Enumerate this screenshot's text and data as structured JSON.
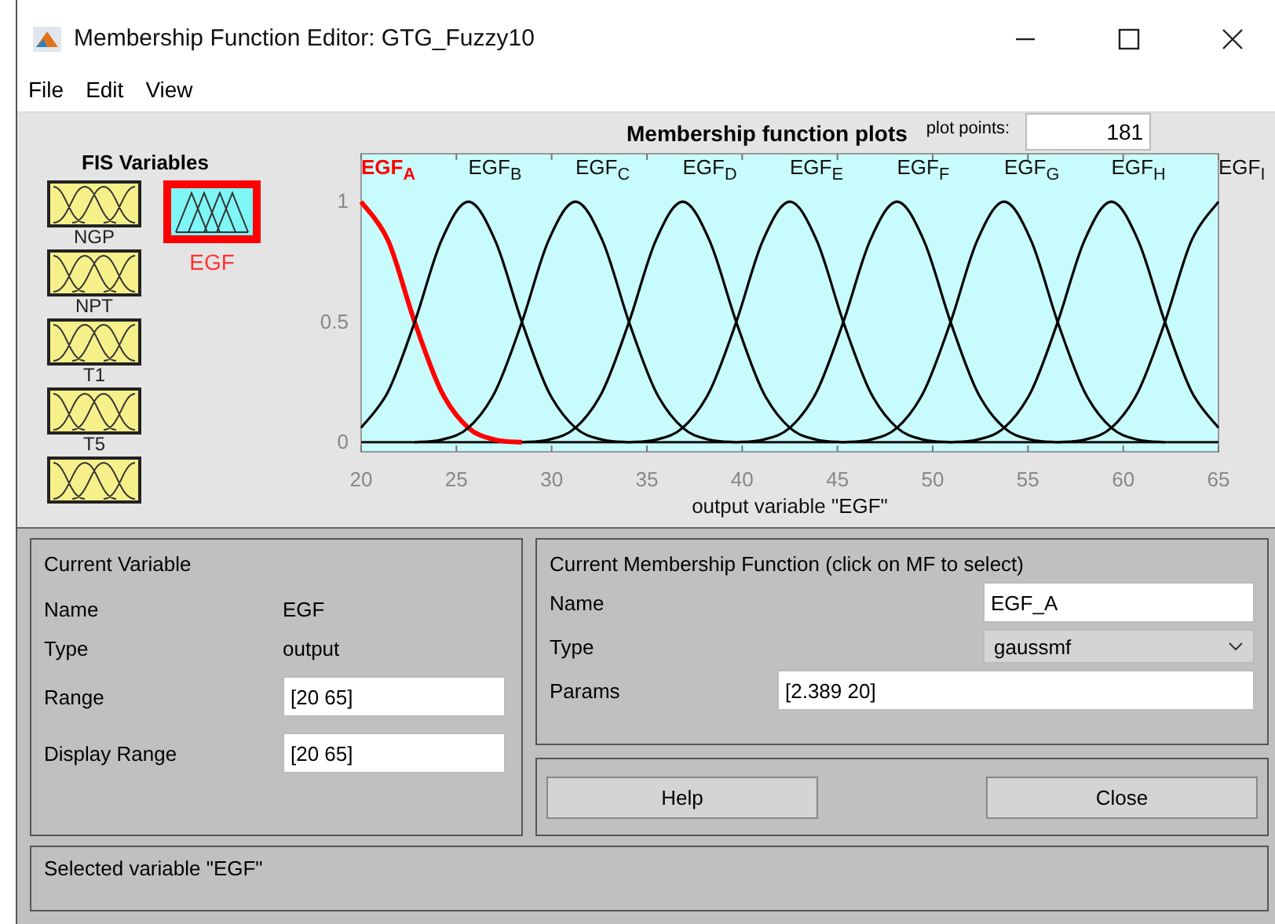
{
  "window": {
    "title": "Membership Function Editor: GTG_Fuzzy10"
  },
  "menu": [
    "File",
    "Edit",
    "View"
  ],
  "fis_variables": {
    "heading": "FIS Variables",
    "items": [
      {
        "name": "NGP",
        "kind": "input",
        "selected": false
      },
      {
        "name": "NPT",
        "kind": "input",
        "selected": false
      },
      {
        "name": "T1",
        "kind": "input",
        "selected": false
      },
      {
        "name": "T5",
        "kind": "input",
        "selected": false
      },
      {
        "kind": "input",
        "selected": false
      },
      {
        "name": "EGF",
        "kind": "output",
        "selected": true
      }
    ]
  },
  "plot": {
    "title": "Membership function plots",
    "plot_points_label": "plot points:",
    "plot_points": "181",
    "selected_mf": [
      true,
      false,
      false,
      false,
      false,
      false,
      false,
      false,
      false
    ],
    "chart_data": {
      "type": "line",
      "xlabel": "output variable \"EGF\"",
      "xlim": [
        20,
        65
      ],
      "ylim": [
        -0.04,
        1.2
      ],
      "xticks": [
        20,
        25,
        30,
        35,
        40,
        45,
        50,
        55,
        60,
        65
      ],
      "yticks": [
        0,
        0.5,
        1
      ],
      "x": [
        20,
        21.41,
        22.81,
        24.22,
        25.63,
        27.03,
        28.44,
        29.84,
        31.25,
        32.66,
        34.06,
        35.47,
        36.88,
        38.28,
        39.69,
        41.09,
        42.5,
        43.91,
        45.31,
        46.72,
        48.13,
        49.53,
        50.94,
        52.34,
        53.75,
        55.16,
        56.56,
        57.97,
        59.38,
        60.78,
        62.19,
        63.59,
        65
      ],
      "series": [
        {
          "name": "EGF$_{A}$",
          "color": "#ff0000",
          "values": [
            1,
            0.84,
            0.5,
            0.21,
            0.06,
            0.01,
            0,
            null,
            null,
            null,
            null,
            null,
            null,
            null,
            null,
            null,
            null,
            null,
            null,
            null,
            null,
            null,
            null,
            null,
            null,
            null,
            null,
            null,
            null,
            null,
            null,
            null,
            null
          ]
        },
        {
          "name": "EGF$_{B}$",
          "color": "#000000",
          "values": [
            0.06,
            0.21,
            0.5,
            0.84,
            1,
            0.84,
            0.5,
            0.21,
            0.06,
            0.01,
            0,
            null,
            null,
            null,
            null,
            null,
            null,
            null,
            null,
            null,
            null,
            null,
            null,
            null,
            null,
            null,
            null,
            null,
            null,
            null,
            null,
            null,
            null
          ]
        },
        {
          "name": "EGF$_{C}$",
          "color": "#000000",
          "values": [
            null,
            null,
            0,
            0.01,
            0.06,
            0.21,
            0.5,
            0.84,
            1,
            0.84,
            0.5,
            0.21,
            0.06,
            0.01,
            0,
            null,
            null,
            null,
            null,
            null,
            null,
            null,
            null,
            null,
            null,
            null,
            null,
            null,
            null,
            null,
            null,
            null,
            null
          ]
        },
        {
          "name": "EGF$_{D}$",
          "color": "#000000",
          "values": [
            null,
            null,
            null,
            null,
            null,
            null,
            0,
            0.01,
            0.06,
            0.21,
            0.5,
            0.84,
            1,
            0.84,
            0.5,
            0.21,
            0.06,
            0.01,
            0,
            null,
            null,
            null,
            null,
            null,
            null,
            null,
            null,
            null,
            null,
            null,
            null,
            null,
            null
          ]
        },
        {
          "name": "EGF$_{E}$",
          "color": "#000000",
          "values": [
            null,
            null,
            null,
            null,
            null,
            null,
            null,
            null,
            null,
            null,
            0,
            0.01,
            0.06,
            0.21,
            0.5,
            0.84,
            1,
            0.84,
            0.5,
            0.21,
            0.06,
            0.01,
            0,
            null,
            null,
            null,
            null,
            null,
            null,
            null,
            null,
            null,
            null
          ]
        },
        {
          "name": "EGF$_{F}$",
          "color": "#000000",
          "values": [
            null,
            null,
            null,
            null,
            null,
            null,
            null,
            null,
            null,
            null,
            null,
            null,
            null,
            null,
            0,
            0.01,
            0.06,
            0.21,
            0.5,
            0.84,
            1,
            0.84,
            0.5,
            0.21,
            0.06,
            0.01,
            0,
            null,
            null,
            null,
            null,
            null,
            null
          ]
        },
        {
          "name": "EGF$_{G}$",
          "color": "#000000",
          "values": [
            null,
            null,
            null,
            null,
            null,
            null,
            null,
            null,
            null,
            null,
            null,
            null,
            null,
            null,
            null,
            null,
            null,
            null,
            0,
            0.01,
            0.06,
            0.21,
            0.5,
            0.84,
            1,
            0.84,
            0.5,
            0.21,
            0.06,
            0.01,
            0,
            null,
            null
          ]
        },
        {
          "name": "EGF$_{H}$",
          "color": "#000000",
          "values": [
            null,
            null,
            null,
            null,
            null,
            null,
            null,
            null,
            null,
            null,
            null,
            null,
            null,
            null,
            null,
            null,
            null,
            null,
            null,
            null,
            null,
            null,
            0,
            0.01,
            0.06,
            0.21,
            0.5,
            0.84,
            1,
            0.84,
            0.5,
            0.21,
            0.06
          ]
        },
        {
          "name": "EGF$_{I}$",
          "color": "#000000",
          "values": [
            null,
            null,
            null,
            null,
            null,
            null,
            null,
            null,
            null,
            null,
            null,
            null,
            null,
            null,
            null,
            null,
            null,
            null,
            null,
            null,
            null,
            null,
            null,
            null,
            null,
            null,
            0,
            0.01,
            0.06,
            0.21,
            0.5,
            0.84,
            1
          ]
        }
      ]
    }
  },
  "current_variable": {
    "heading": "Current Variable",
    "name_label": "Name",
    "name": "EGF",
    "type_label": "Type",
    "type": "output",
    "range_label": "Range",
    "range": "[20 65]",
    "display_range_label": "Display Range",
    "display_range": "[20 65]"
  },
  "current_mf": {
    "heading": "Current Membership Function (click on MF to select)",
    "name_label": "Name",
    "name": "EGF_A",
    "type_label": "Type",
    "type": "gaussmf",
    "params_label": "Params",
    "params": "[2.389 20]"
  },
  "buttons": [
    "Help",
    "Close"
  ],
  "status": "Selected variable \"EGF\""
}
